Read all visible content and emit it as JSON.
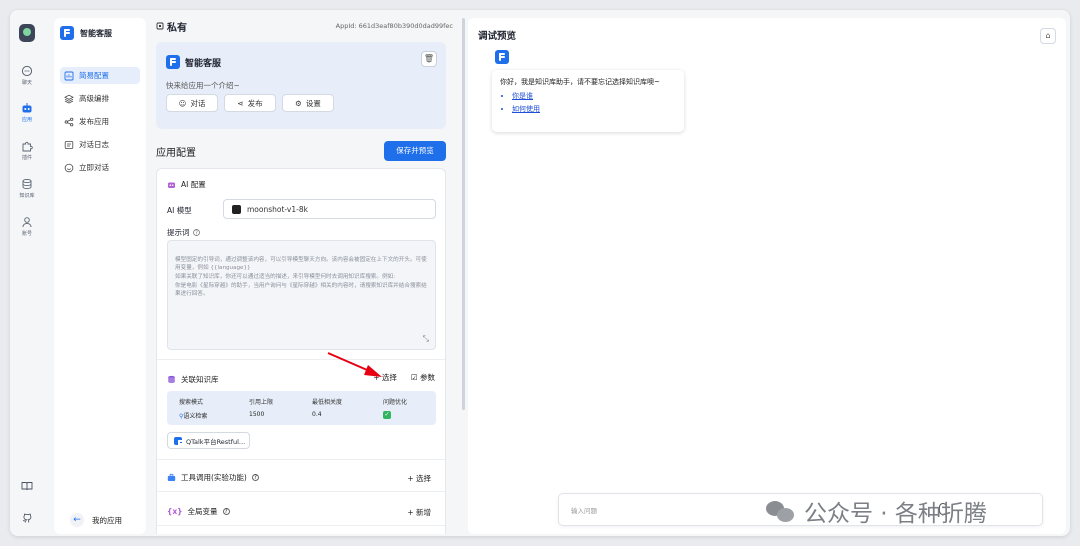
{
  "rail": {
    "items": [
      {
        "label": "聊天",
        "icon": "chat-icon"
      },
      {
        "label": "应用",
        "icon": "robot-icon"
      },
      {
        "label": "插件",
        "icon": "puzzle-icon"
      },
      {
        "label": "知识库",
        "icon": "database-icon"
      },
      {
        "label": "账号",
        "icon": "user-icon"
      }
    ]
  },
  "sidebar": {
    "brand": "智能客服",
    "items": [
      {
        "label": "简易配置",
        "icon": "layout-icon",
        "active": true
      },
      {
        "label": "高级编排",
        "icon": "layers-icon",
        "active": false
      },
      {
        "label": "发布应用",
        "icon": "share-icon",
        "active": false
      },
      {
        "label": "对话日志",
        "icon": "log-icon",
        "active": false
      },
      {
        "label": "立即对话",
        "icon": "chat-icon",
        "active": false
      }
    ],
    "back_label": "我的应用"
  },
  "editor": {
    "visibility": "私有",
    "app_id": "AppId: 661d3eaf80b390d0dad99fec",
    "app_name": "智能客服",
    "app_intro": "快来给应用一个介绍~",
    "card_buttons": [
      "对话",
      "发布",
      "设置"
    ],
    "config_title": "应用配置",
    "save_label": "保存并预览",
    "ai_config_title": "AI 配置",
    "model_label": "AI 模型",
    "model_value": "moonshot-v1-8k",
    "prompt_label": "提示词",
    "prompt_placeholder": "模型固定的引导词，通过调整该内容，可以引导模型聊天方向。该内容会被固定在上下文的开头。可使用变量，例如 {{language}}\n如果关联了知识库，你还可以通过适当的描述，来引导模型何时去调用知识库搜索。例如:\n你是电影《星际穿越》的助手，当用户询问与《星际穿越》相关的内容时，请搜索知识库并结合搜索结果进行回答。",
    "kb_title": "关联知识库",
    "kb_select": "+ 选择",
    "kb_params": "参数",
    "kb_table": {
      "headers": [
        "搜索模式",
        "引用上限",
        "最低相关度",
        "问题优化"
      ],
      "row": [
        "语义检索",
        "1500",
        "0.4",
        "✓"
      ]
    },
    "kb_chip": "QTalk平台Restful...",
    "tool_title": "工具调用(实验功能)",
    "tool_action": "+ 选择",
    "var_title": "全局变量",
    "var_action": "+ 新增"
  },
  "preview": {
    "title": "调试预览",
    "greeting": "你好，我是知识库助手，请不要忘记选择知识库噢~",
    "links": [
      "你是谁",
      "如何使用"
    ],
    "input_placeholder": "输入问题"
  },
  "watermark": "公众号 · 各种折腾",
  "colors": {
    "accent": "#1f6feb",
    "arrow": "#e60012",
    "check": "#2fb55d"
  }
}
